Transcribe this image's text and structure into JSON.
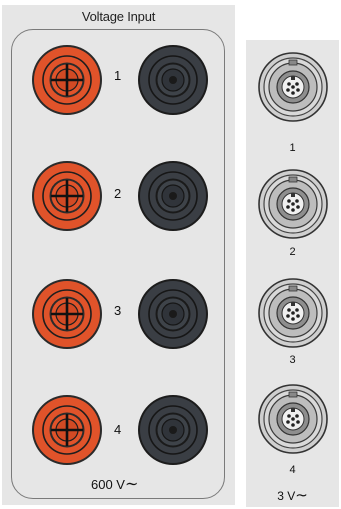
{
  "voltage_panel": {
    "title": "Voltage Input",
    "channels": [
      {
        "label": "1"
      },
      {
        "label": "2"
      },
      {
        "label": "3"
      },
      {
        "label": "4"
      }
    ],
    "rating": "600 V",
    "rating_symbol": "∼"
  },
  "sensor_panel": {
    "channels": [
      {
        "label": "1"
      },
      {
        "label": "2"
      },
      {
        "label": "3"
      },
      {
        "label": "4"
      }
    ],
    "rating": "3 V",
    "rating_symbol": "∼"
  },
  "colors": {
    "red_jack": "#e0532a",
    "black_jack": "#3a3e44",
    "panel_bg": "#e6e6e6",
    "outline": "#7a7a7a"
  },
  "icons": {
    "red_jack": "banana-jack-red-icon",
    "black_jack": "banana-jack-black-icon",
    "sensor_connector": "lemo-connector-icon"
  }
}
